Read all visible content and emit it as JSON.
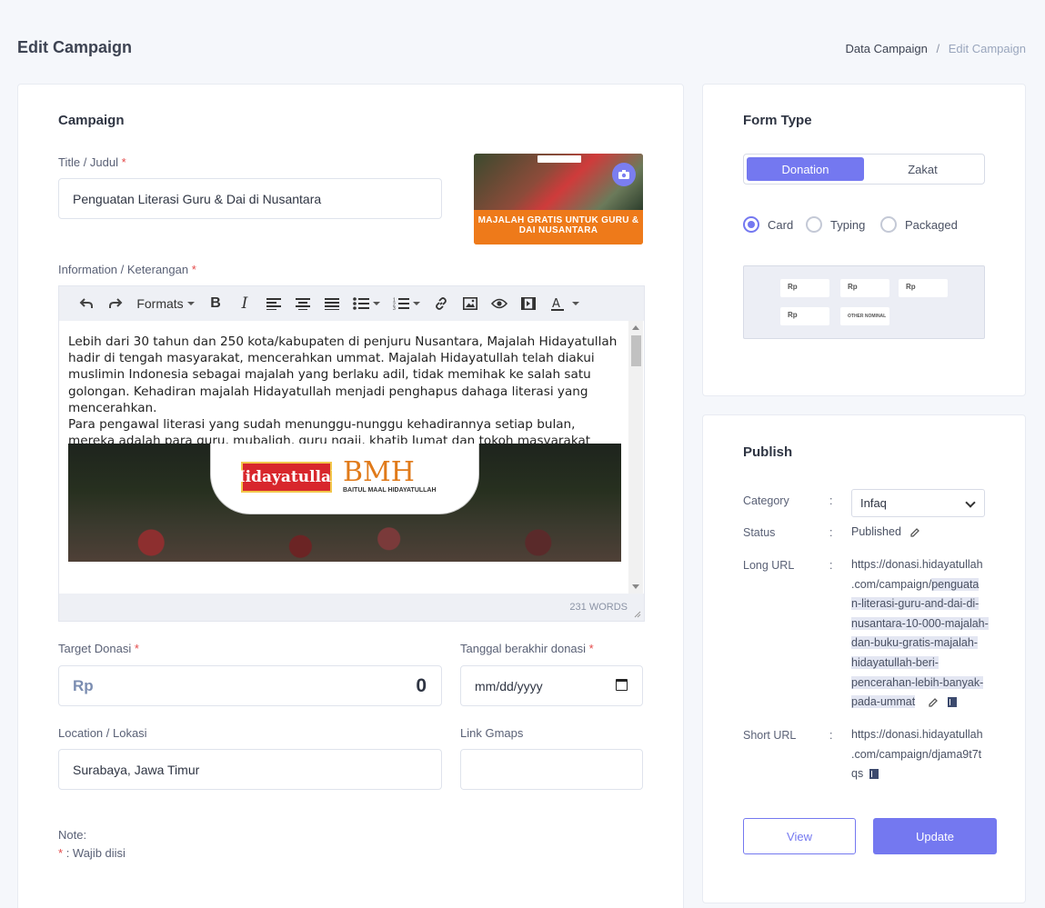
{
  "header": {
    "title": "Edit Campaign",
    "breadcrumb": [
      "Data Campaign",
      "Edit Campaign"
    ],
    "breadcrumb_sep": "/"
  },
  "campaign": {
    "section_title": "Campaign",
    "title_label": "Title / Judul",
    "title_value": "Penguatan Literasi Guru & Dai di Nusantara",
    "thumbnail_caption": "MAJALAH GRATIS UNTUK GURU & DAI NUSANTARA",
    "info_label": "Information / Keterangan",
    "editor": {
      "formats_label": "Formats",
      "paragraph1": "Lebih dari 30 tahun dan 250 kota/kabupaten di penjuru Nusantara, Majalah Hidayatullah hadir di tengah masyarakat, mencerahkan ummat. Majalah Hidayatullah telah diakui muslimin Indonesia sebagai majalah yang berlaku adil, tidak memihak ke salah satu golongan. Kehadiran majalah Hidayatullah menjadi penghapus dahaga literasi yang mencerahkan.",
      "paragraph2": "Para pengawal literasi yang sudah menunggu-nunggu kehadirannya setiap bulan, mereka adalah para guru, mubaligh, guru ngaji, khatib Jumat dan tokoh masyarakat lokal, yang sehari-hari menjadi penyuluh ummat.",
      "image_logo_left": "Hidayatullah",
      "image_logo_right": "BMH",
      "image_logo_right_sub": "BAITUL MAAL HIDAYATULLAH",
      "word_count": "231 WORDS"
    },
    "target_label": "Target Donasi",
    "currency": "Rp",
    "target_value": "0",
    "deadline_label": "Tanggal berakhir donasi",
    "deadline_placeholder": "mm/dd/yyyy",
    "location_label": "Location / Lokasi",
    "location_value": "Surabaya, Jawa Timur",
    "gmaps_label": "Link Gmaps",
    "gmaps_value": "",
    "required_mark": "*",
    "note_title": "Note:",
    "note_text": ": Wajib diisi"
  },
  "form_type": {
    "section_title": "Form Type",
    "options": [
      "Donation",
      "Zakat"
    ],
    "selected": "Donation",
    "display_options": [
      "Card",
      "Typing",
      "Packaged"
    ],
    "display_selected": "Card",
    "preview": {
      "currency": "Rp",
      "other_nominal": "OTHER NOMINAL"
    }
  },
  "publish": {
    "section_title": "Publish",
    "colon": ":",
    "category_label": "Category",
    "category_value": "Infaq",
    "status_label": "Status",
    "status_value": "Published",
    "long_url_label": "Long URL",
    "long_url_base_1": "https://donasi.hidayatullah",
    "long_url_base_2": ".com/campaign/",
    "long_url_slug": [
      "penguata",
      "n-literasi-guru-and-dai-di-",
      "nusantara-10-000-majalah-",
      "dan-buku-gratis-majalah-",
      "hidayatullah-beri-",
      "pencerahan-lebih-banyak-",
      "pada-ummat"
    ],
    "short_url_label": "Short URL",
    "short_url_lines": [
      "https://donasi.hidayatullah",
      ".com/campaign/djama9t7t",
      "qs"
    ],
    "view_label": "View",
    "update_label": "Update"
  },
  "colors": {
    "accent": "#7478f0",
    "required": "#e44a4a"
  }
}
